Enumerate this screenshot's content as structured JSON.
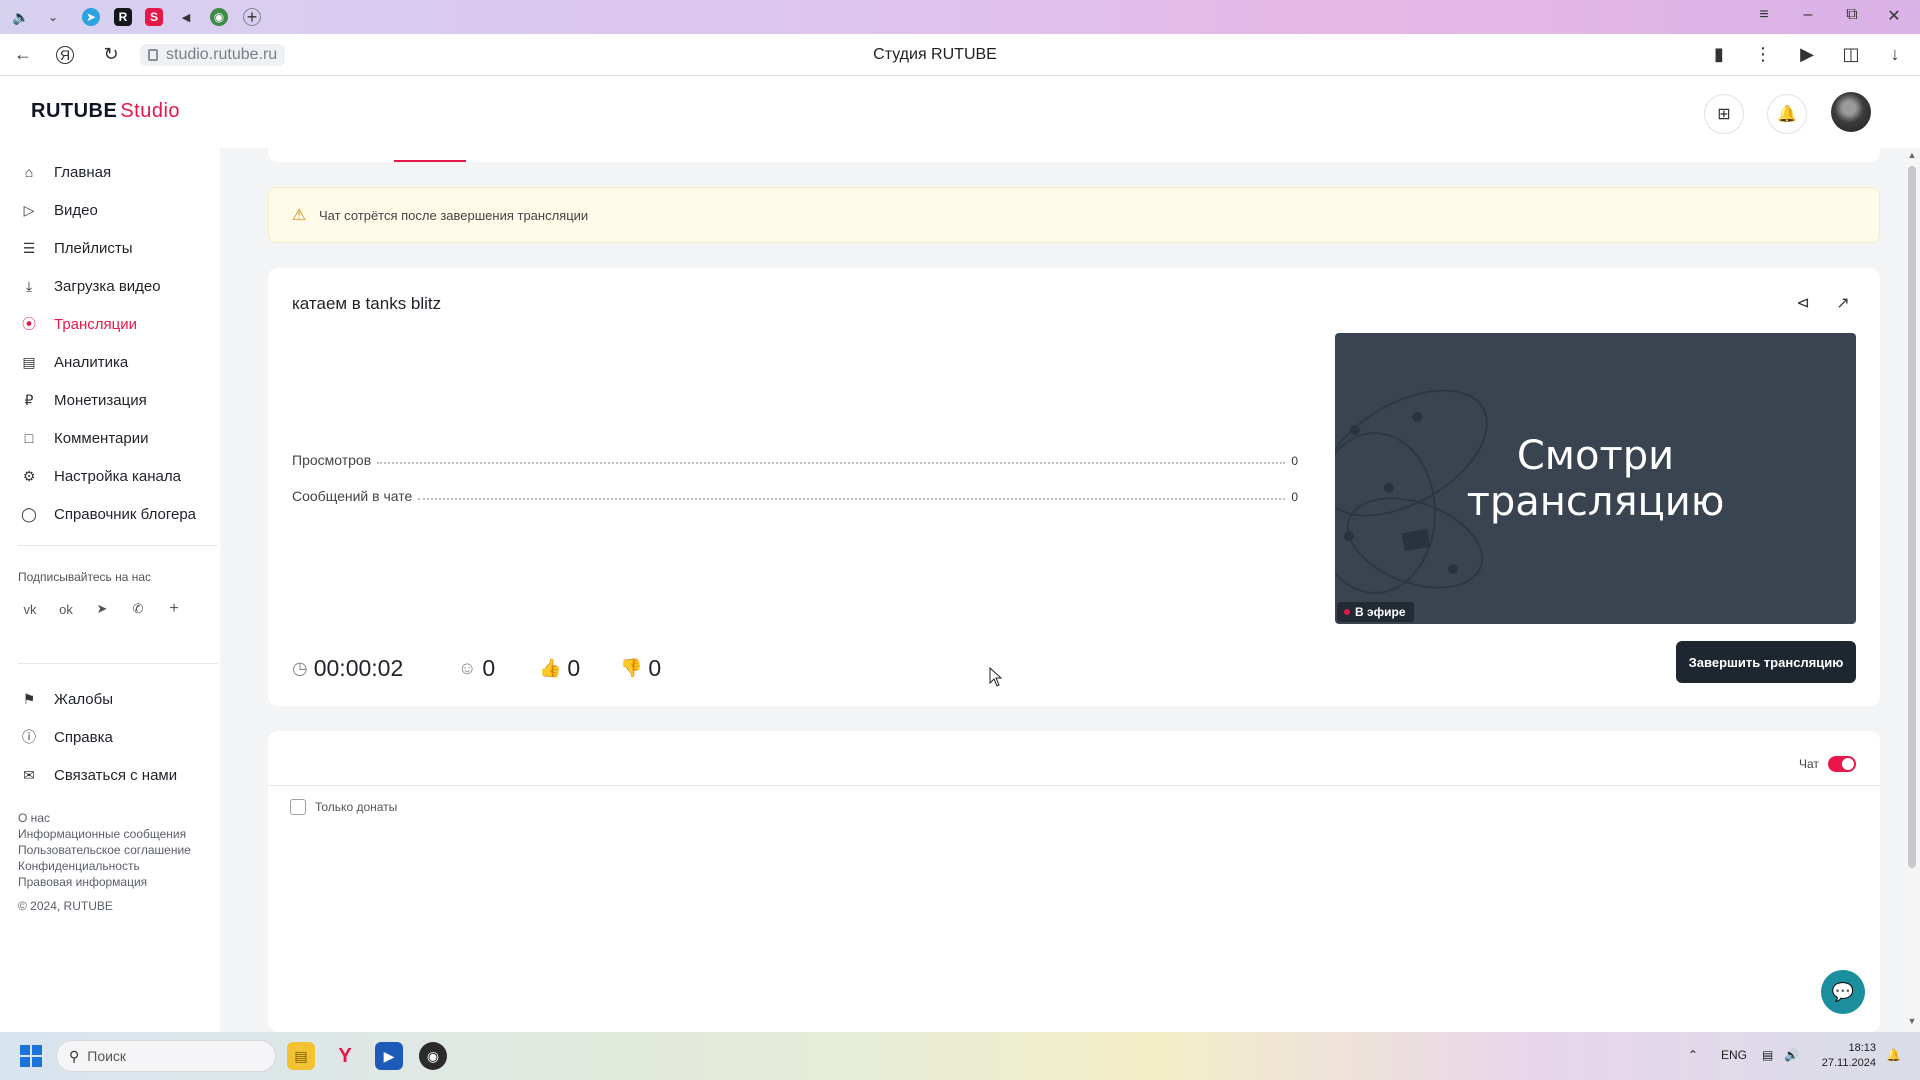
{
  "browser": {
    "url": "studio.rutube.ru",
    "page_title": "Студия RUTUBE"
  },
  "app": {
    "logo_main": "RUTUBE",
    "logo_studio": "Studio"
  },
  "sidebar": {
    "items": [
      {
        "label": "Главная",
        "icon": "home-icon"
      },
      {
        "label": "Видео",
        "icon": "video-icon"
      },
      {
        "label": "Плейлисты",
        "icon": "list-icon"
      },
      {
        "label": "Загрузка видео",
        "icon": "upload-icon"
      },
      {
        "label": "Трансляции",
        "icon": "broadcast-icon",
        "active": true
      },
      {
        "label": "Аналитика",
        "icon": "analytics-icon"
      },
      {
        "label": "Монетизация",
        "icon": "ruble-icon"
      },
      {
        "label": "Комментарии",
        "icon": "comment-icon"
      },
      {
        "label": "Настройка канала",
        "icon": "gear-icon"
      },
      {
        "label": "Справочник блогера",
        "icon": "book-icon"
      }
    ],
    "follow_label": "Подписывайтесь на нас",
    "social": [
      "vk-icon",
      "ok-icon",
      "telegram-icon",
      "viber-icon",
      "plus-icon"
    ],
    "secondary": [
      {
        "label": "Жалобы",
        "icon": "flag-icon"
      },
      {
        "label": "Справка",
        "icon": "help-icon"
      },
      {
        "label": "Связаться с нами",
        "icon": "mail-icon"
      }
    ],
    "footer_links": [
      "О нас",
      "Информационные сообщения",
      "Пользовательское соглашение",
      "Конфиденциальность",
      "Правовая информация"
    ],
    "copyright": "© 2024, RUTUBE"
  },
  "alert": {
    "text": "Чат сотрётся после завершения трансляции"
  },
  "stream": {
    "title": "катаем в tanks blitz",
    "stats": [
      {
        "label": "Просмотров",
        "value": "0"
      },
      {
        "label": "Сообщений в чате",
        "value": "0"
      }
    ],
    "preview_text_line1": "Смотри",
    "preview_text_line2": "трансляцию",
    "live_badge": "В эфире",
    "end_button": "Завершить трансляцию",
    "duration": "00:00:02",
    "viewers": "0",
    "likes": "0",
    "dislikes": "0"
  },
  "chat": {
    "toggle_label": "Чат",
    "toggle_on": true,
    "donations_only_label": "Только донаты",
    "donations_only_checked": false
  },
  "taskbar": {
    "search_placeholder": "Поиск",
    "lang": "ENG",
    "time": "18:13",
    "date": "27.11.2024"
  },
  "colors": {
    "accent": "#e8174a",
    "dark_button": "#1e2630",
    "alert_bg": "#fffbe8"
  }
}
